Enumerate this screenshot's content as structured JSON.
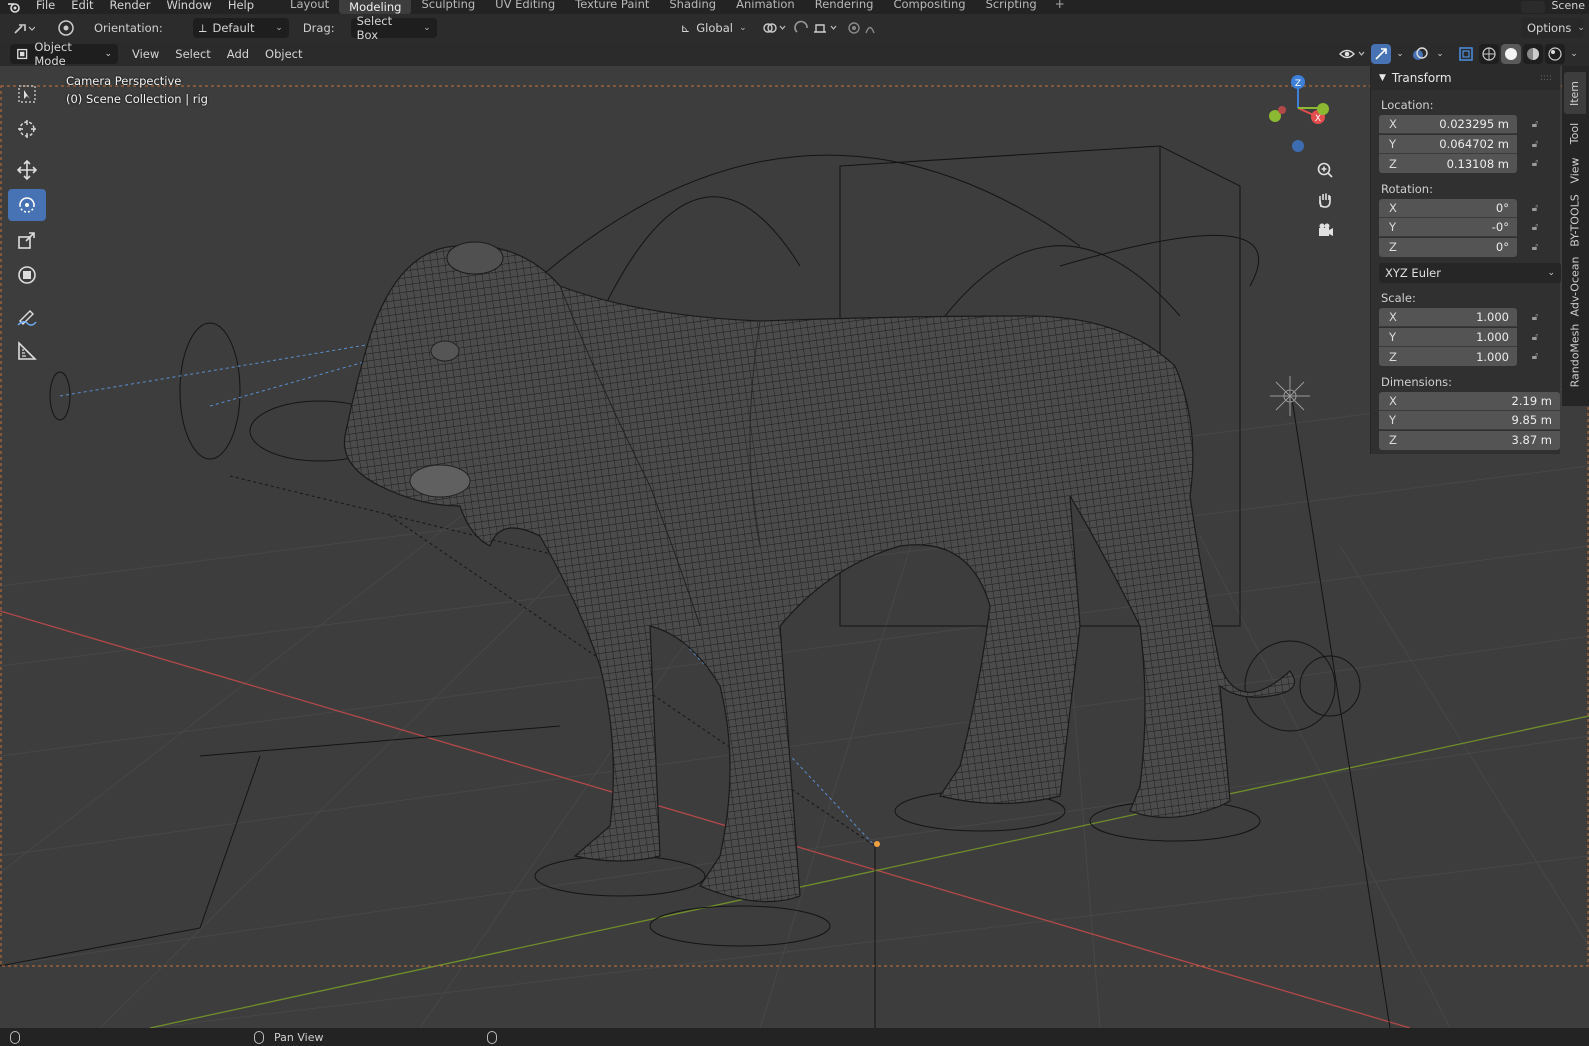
{
  "menubar": {
    "items": [
      "File",
      "Edit",
      "Render",
      "Window",
      "Help"
    ],
    "workspaces": [
      "Layout",
      "Modeling",
      "Sculpting",
      "UV Editing",
      "Texture Paint",
      "Shading",
      "Animation",
      "Rendering",
      "Compositing",
      "Scripting"
    ],
    "active_workspace": "Modeling",
    "add_tab": "+",
    "scene_label": "Scene"
  },
  "tool_header": {
    "orientation_label": "Orientation:",
    "orientation_value": "Default",
    "drag_label": "Drag:",
    "drag_value": "Select Box",
    "transform_orientation": "Global",
    "options_label": "Options"
  },
  "view_header": {
    "mode": "Object Mode",
    "menus": [
      "View",
      "Select",
      "Add",
      "Object"
    ]
  },
  "viewport": {
    "camera_text": "Camera Perspective",
    "collection_text": "(0) Scene Collection | rig"
  },
  "gizmo": {
    "x": "X",
    "y": "Y",
    "z": "Z"
  },
  "transform_panel": {
    "title": "Transform",
    "location_label": "Location:",
    "location": [
      {
        "axis": "X",
        "value": "0.023295 m"
      },
      {
        "axis": "Y",
        "value": "0.064702 m"
      },
      {
        "axis": "Z",
        "value": "0.13108 m"
      }
    ],
    "rotation_label": "Rotation:",
    "rotation": [
      {
        "axis": "X",
        "value": "0°"
      },
      {
        "axis": "Y",
        "value": "-0°"
      },
      {
        "axis": "Z",
        "value": "0°"
      }
    ],
    "rotation_mode": "XYZ Euler",
    "scale_label": "Scale:",
    "scale": [
      {
        "axis": "X",
        "value": "1.000"
      },
      {
        "axis": "Y",
        "value": "1.000"
      },
      {
        "axis": "Z",
        "value": "1.000"
      }
    ],
    "dimensions_label": "Dimensions:",
    "dimensions": [
      {
        "axis": "X",
        "value": "2.19 m"
      },
      {
        "axis": "Y",
        "value": "9.85 m"
      },
      {
        "axis": "Z",
        "value": "3.87 m"
      }
    ]
  },
  "sidebar_tabs": [
    "Item",
    "Tool",
    "View",
    "BY-TOOLS",
    "Adv-Ocean",
    "RandoMesh"
  ],
  "statusbar": {
    "middle_action": "Pan View"
  },
  "colors": {
    "accent": "#4772b3",
    "x_axis": "#e24d4d",
    "y_axis": "#8bb932",
    "z_axis": "#3d7fd9",
    "viewport_bg": "#3d3d3d"
  }
}
